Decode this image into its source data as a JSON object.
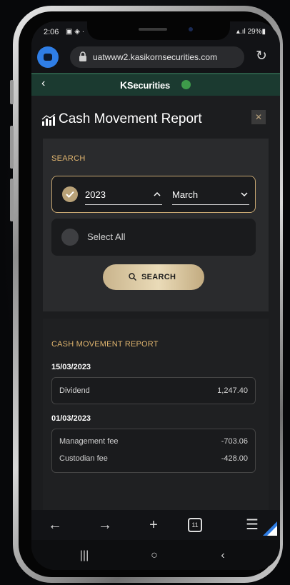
{
  "status_bar": {
    "time": "2:06",
    "left_icons": "▣ ◈ ·",
    "right_text": "▴.ıl 29%▮"
  },
  "browser": {
    "url": "uatwww2.kasikornsecurities.com",
    "reload_icon": "reload-icon",
    "bottom_tab_count": "11"
  },
  "app_header": {
    "back_label": "‹",
    "logo_k": "K",
    "logo_text": "Securities"
  },
  "page": {
    "title": "Cash Movement Report",
    "close_label": "✕"
  },
  "search": {
    "section_label": "SEARCH",
    "year": "2023",
    "month": "March",
    "select_all_label": "Select All",
    "search_button_label": "SEARCH"
  },
  "report": {
    "section_label": "CASH MOVEMENT REPORT",
    "groups": [
      {
        "date": "15/03/2023",
        "items": [
          {
            "label": "Dividend",
            "amount": "1,247.40"
          }
        ]
      },
      {
        "date": "01/03/2023",
        "items": [
          {
            "label": "Management fee",
            "amount": "-703.06"
          },
          {
            "label": "Custodian fee",
            "amount": "-428.00"
          }
        ]
      }
    ]
  },
  "bottom_bar": {
    "back": "←",
    "forward": "→",
    "new_tab": "+",
    "menu": "☰"
  },
  "android_nav": {
    "recents": "|||",
    "home": "○",
    "back": "‹"
  },
  "colors": {
    "accent_gold": "#e0b56f",
    "header_green": "#1b3a30",
    "browser_tab_blue": "#2f7ee6"
  }
}
